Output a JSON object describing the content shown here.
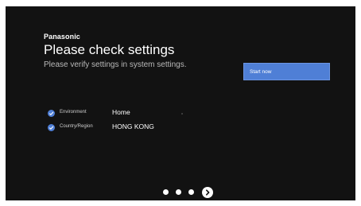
{
  "brand": "Panasonic",
  "title": "Please check settings",
  "subtitle": "Please verify settings in system settings.",
  "start_button": "Start now",
  "settings": [
    {
      "label": "Environment",
      "value": "Home"
    },
    {
      "label": "Country/Region",
      "value": "HONG KONG"
    }
  ],
  "pager": {
    "pages": 4,
    "current_page": 4,
    "icon": "chevron-right-icon"
  },
  "colors": {
    "background": "#121212",
    "accent": "#4f7fd6",
    "text": "#ffffff"
  }
}
